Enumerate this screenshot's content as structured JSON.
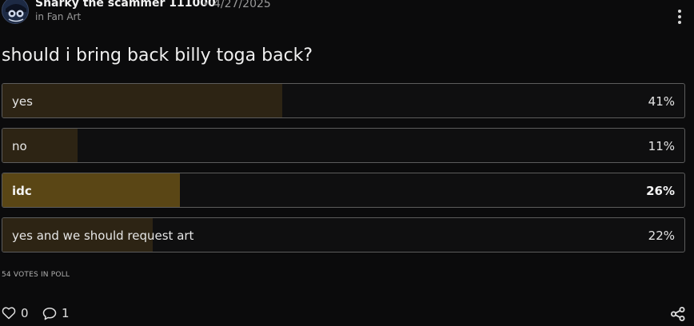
{
  "post": {
    "author": "Sharky the scammer 111000",
    "separator": "•",
    "date": "4/27/2025",
    "community": "in Fan Art"
  },
  "poll": {
    "question": "should i bring back billy toga back?",
    "options": [
      {
        "label": "yes",
        "percent_text": "41%",
        "percent": 41,
        "selected": false
      },
      {
        "label": "no",
        "percent_text": "11%",
        "percent": 11,
        "selected": false
      },
      {
        "label": "idc",
        "percent_text": "26%",
        "percent": 26,
        "selected": true
      },
      {
        "label": "yes and we should request art",
        "percent_text": "22%",
        "percent": 22,
        "selected": false
      }
    ],
    "votes_text": "54 VOTES IN POLL"
  },
  "footer": {
    "likes": "0",
    "comments": "1"
  },
  "icons": {
    "more": "more-vertical-icon",
    "like": "heart-icon",
    "comment": "comment-icon",
    "share": "share-icon"
  },
  "colors": {
    "background": "#0b0b0c",
    "fill": "#2d2414",
    "fill_selected": "#5a4615",
    "border": "#5c5c5c"
  }
}
